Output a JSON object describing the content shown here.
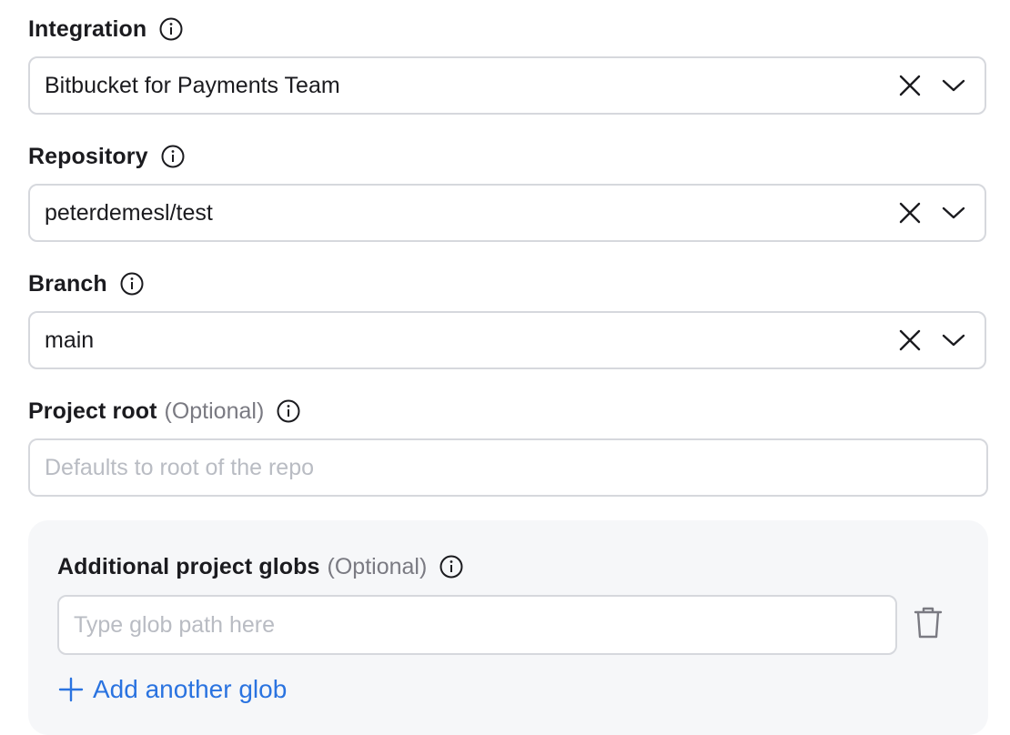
{
  "integration": {
    "label": "Integration",
    "value": "Bitbucket for Payments Team"
  },
  "repository": {
    "label": "Repository",
    "value": "peterdemesl/test"
  },
  "branch": {
    "label": "Branch",
    "value": "main"
  },
  "project_root": {
    "label": "Project root",
    "optional": "(Optional)",
    "placeholder": "Defaults to root of the repo",
    "value": ""
  },
  "globs": {
    "label": "Additional project globs",
    "optional": "(Optional)",
    "placeholder": "Type glob path here",
    "add_label": "Add another glob"
  },
  "icons": {
    "info": "info-icon",
    "clear": "close-icon",
    "dropdown": "chevron-down-icon",
    "delete": "trash-icon",
    "add": "plus-icon"
  },
  "colors": {
    "accent": "#2a73e0",
    "border": "#d6d8dd",
    "panel": "#f6f7f9",
    "placeholder": "#b9bcc3",
    "muted": "#7a7a82"
  }
}
